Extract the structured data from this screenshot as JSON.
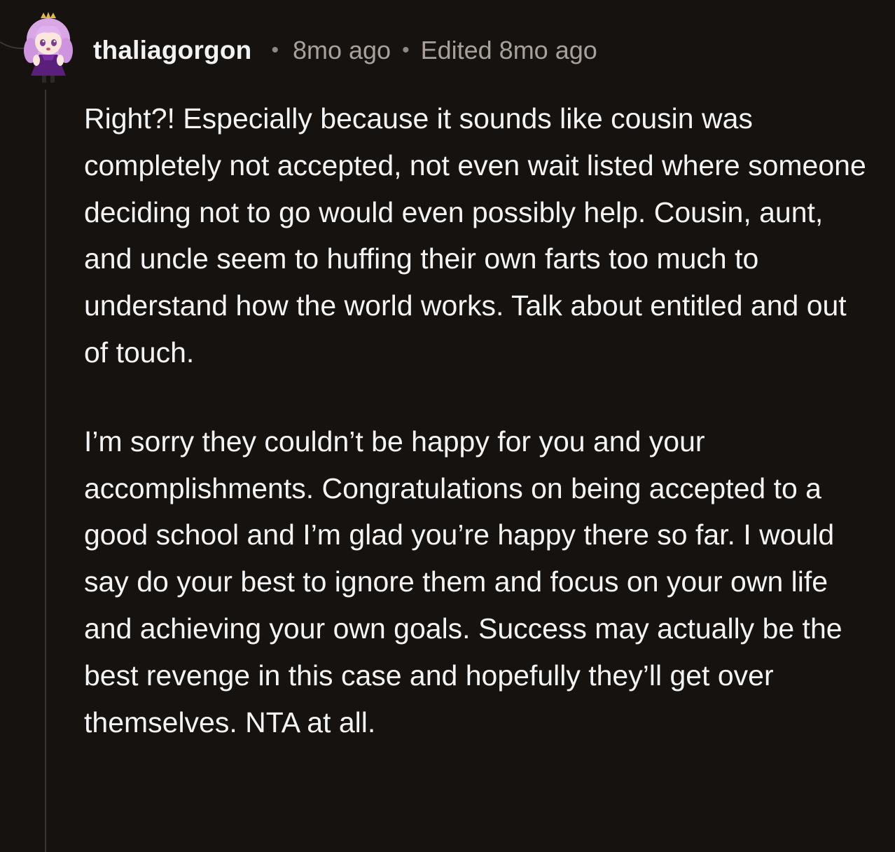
{
  "comment": {
    "username": "thaliagorgon",
    "separator": "•",
    "time": "8mo ago",
    "edited": "Edited 8mo ago",
    "avatar_icon": "anime-avatar-icon",
    "colors": {
      "background": "#161210",
      "text": "#f4f4f4",
      "meta": "#a8a19b",
      "thread_line": "#3a3633"
    },
    "paragraphs": [
      "Right?! Especially because it sounds like cousin was completely not accepted, not even wait listed where someone deciding not to go would even possibly help. Cousin, aunt, and uncle seem to huffing their own farts too much to understand how the world works. Talk about entitled and out of touch.",
      "I’m sorry they couldn’t be happy for you and your accomplishments. Congratulations on being accepted to a good school and I’m glad you’re happy there so far. I would say do your best to ignore them and focus on your own life and achieving your own goals. Success may actually be the best revenge in this case and hopefully they’ll get over themselves. NTA at all."
    ]
  }
}
